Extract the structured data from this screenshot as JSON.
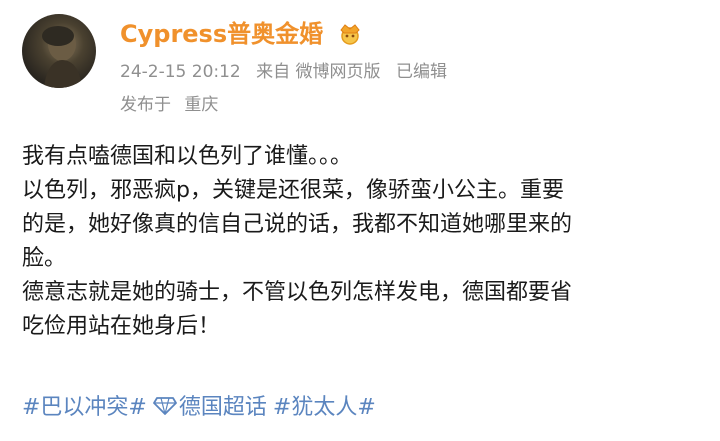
{
  "post": {
    "author": "Cypress普奥金婚",
    "timestamp": "24-2-15 20:12",
    "source": "来自 微博网页版",
    "edited": "已编辑",
    "location_prefix": "发布于",
    "location": "重庆",
    "lines": [
      "我有点嗑德国和以色列了谁懂。。。",
      "以色列，邪恶疯p，关键是还很菜，像骄蛮小公主。重要",
      "的是，她好像真的信自己说的话，我都不知道她哪里来的",
      "脸。",
      "德意志就是她的骑士，不管以色列怎样发电，德国都要省",
      "吃俭用站在她身后！"
    ],
    "tags": [
      {
        "label": "#巴以冲突#",
        "icon": "none"
      },
      {
        "label": "德国超话",
        "icon": "diamond-icon"
      },
      {
        "label": "#犹太人#",
        "icon": "none"
      }
    ]
  },
  "colors": {
    "username": "#f0912c",
    "meta": "#8f8f8f",
    "text": "#1a1a1a",
    "tag": "#5b85bf"
  }
}
